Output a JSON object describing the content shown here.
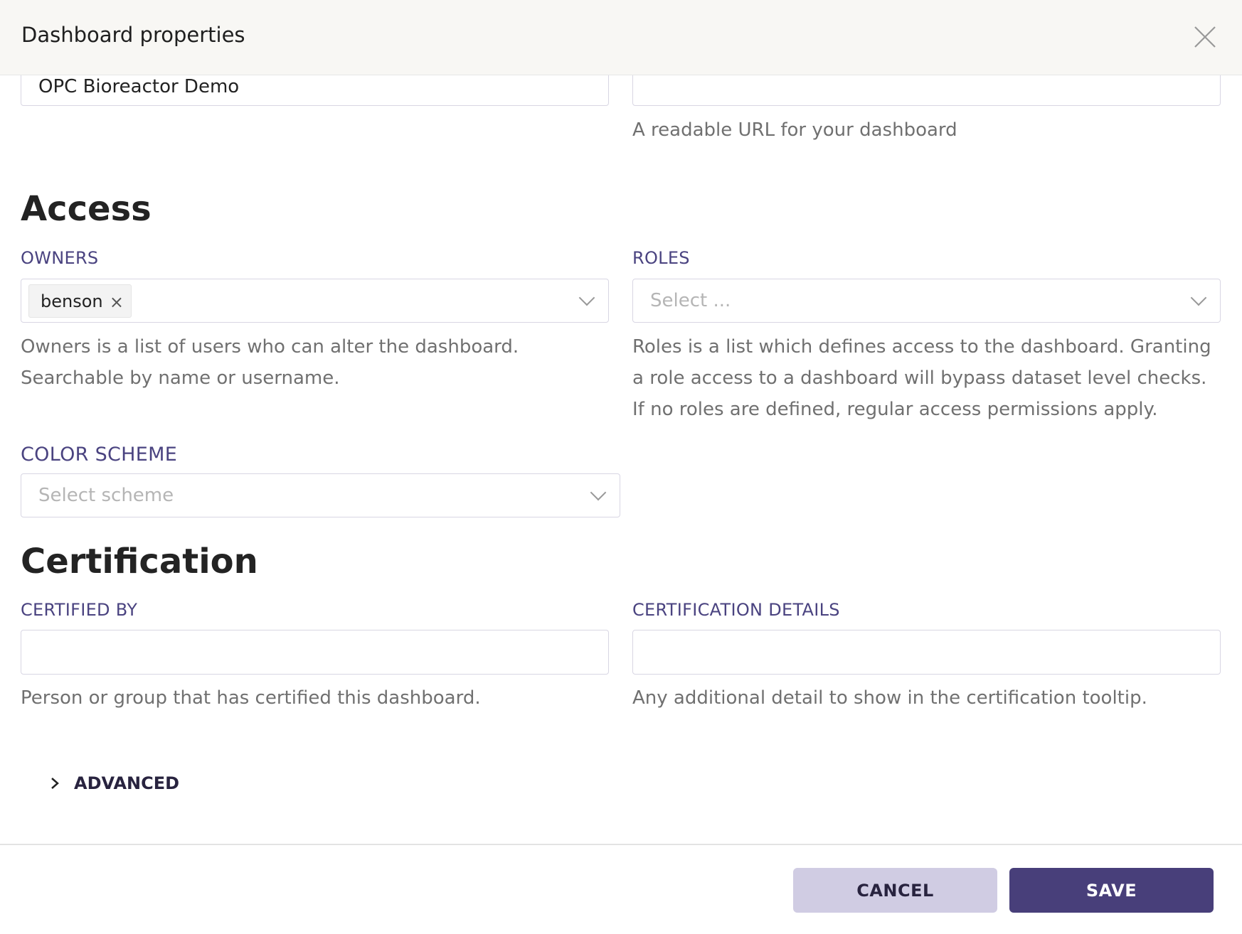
{
  "header": {
    "title": "Dashboard properties",
    "close_icon": "close-icon"
  },
  "basic": {
    "title_value": "OPC Bioreactor Demo",
    "slug_value": "",
    "slug_help": "A readable URL for your dashboard"
  },
  "access": {
    "heading": "Access",
    "owners": {
      "label": "OWNERS",
      "tags": [
        "benson"
      ],
      "remove_glyph": "×",
      "help_lines": [
        "Owners is a list of users who can alter the dashboard.",
        "Searchable by name or username."
      ]
    },
    "roles": {
      "label": "ROLES",
      "placeholder": "Select ...",
      "help_lines": [
        "Roles is a list which defines access to the dashboard. Granting",
        "a role access to a dashboard will bypass dataset level checks.",
        "If no roles are defined, regular access permissions apply."
      ]
    },
    "color_scheme": {
      "label": "COLOR SCHEME",
      "placeholder": "Select scheme"
    }
  },
  "certification": {
    "heading": "Certification",
    "certified_by": {
      "label": "CERTIFIED BY",
      "value": "",
      "help": "Person or group that has certified this dashboard."
    },
    "details": {
      "label": "CERTIFICATION DETAILS",
      "value": "",
      "help": "Any additional detail to show in the certification tooltip."
    }
  },
  "advanced": {
    "label": "ADVANCED"
  },
  "footer": {
    "cancel_label": "CANCEL",
    "save_label": "SAVE"
  },
  "colors": {
    "primary": "#483f7a",
    "secondary": "#d0cce3",
    "label": "#4a4380",
    "header_bg": "#f8f7f4"
  }
}
